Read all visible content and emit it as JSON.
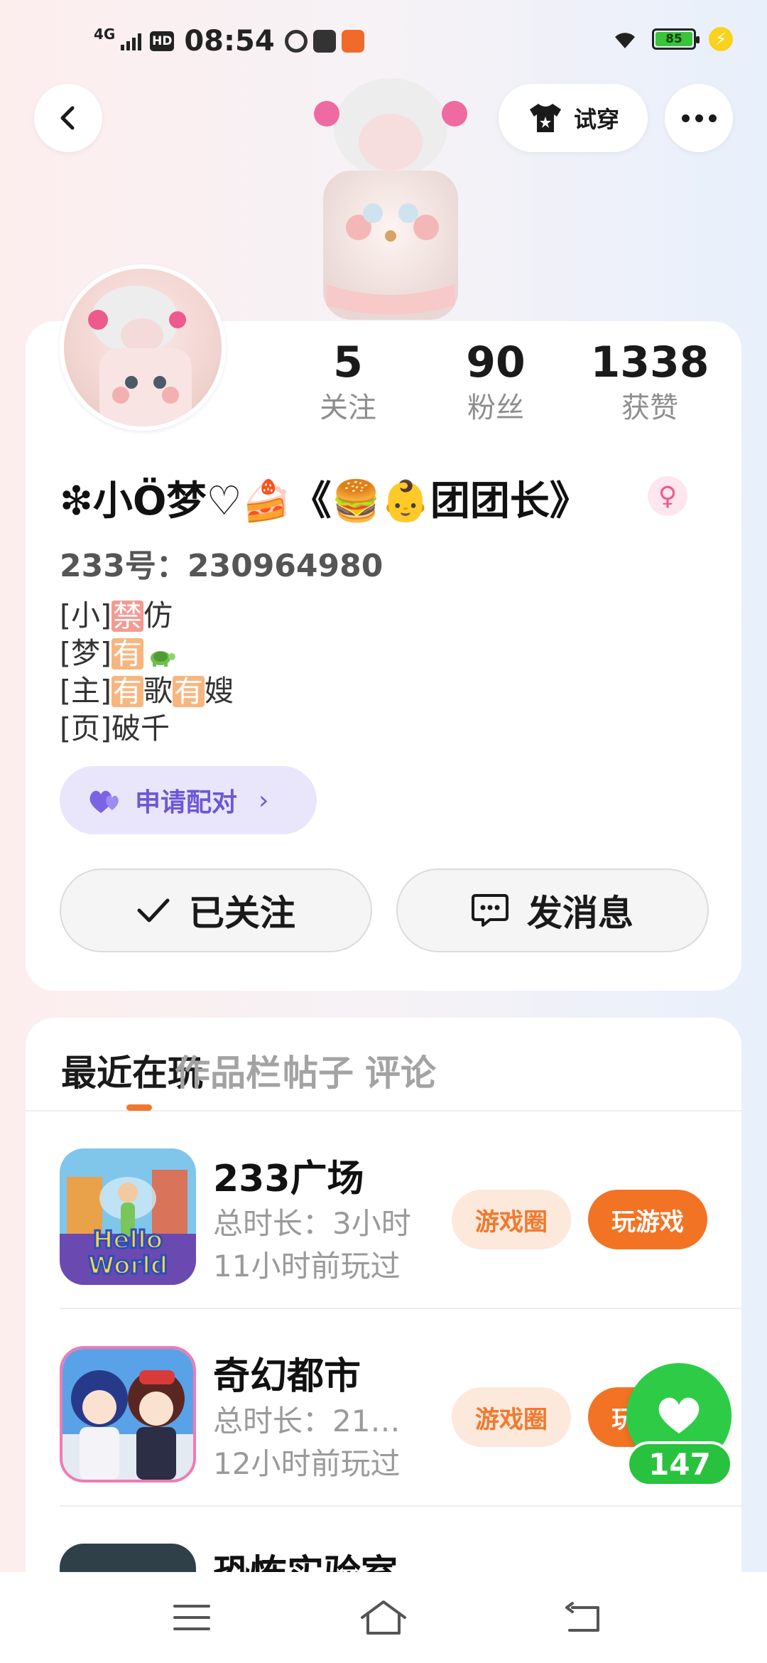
{
  "status_bar": {
    "network": "4G",
    "hd": "HD",
    "time": "08:54",
    "battery": "85"
  },
  "header": {
    "tryon_label": "试穿"
  },
  "profile": {
    "stats": [
      {
        "value": "5",
        "label": "关注"
      },
      {
        "value": "90",
        "label": "粉丝"
      },
      {
        "value": "1338",
        "label": "获赞"
      }
    ],
    "nickname": "❇小Ö梦♡🍰《🍔👶团团长》",
    "gender_symbol": "♀",
    "uid": "233号：230964980",
    "bio": [
      {
        "prefix": "[小]",
        "highlight": "禁",
        "rest": "仿"
      },
      {
        "prefix": "[梦]",
        "highlight": "有",
        "rest": ""
      },
      {
        "prefix": "[主]",
        "highlight": "有",
        "mid": "歌",
        "highlight2": "有",
        "rest": "嫂"
      },
      {
        "prefix": "[页]",
        "rest": "破千"
      }
    ],
    "pair_label": "申请配对",
    "follow_label": "已关注",
    "message_label": "发消息"
  },
  "tabs": [
    "最近在玩",
    "作品栏",
    "帖子",
    "评论"
  ],
  "games": [
    {
      "title": "233广场",
      "duration": "总时长：3小时",
      "last_played": "11小时前玩过",
      "circle_label": "游戏圈",
      "play_label": "玩游戏"
    },
    {
      "title": "奇幻都市",
      "duration": "总时长：21…",
      "last_played": "12小时前玩过",
      "circle_label": "游戏圈",
      "play_label": "玩游戏"
    },
    {
      "title": "恐怖实验室"
    }
  ],
  "like": {
    "count": "147"
  },
  "colors": {
    "accent_orange": "#f37324",
    "like_green": "#2ecc46",
    "pair_purple": "#6c58d8"
  }
}
